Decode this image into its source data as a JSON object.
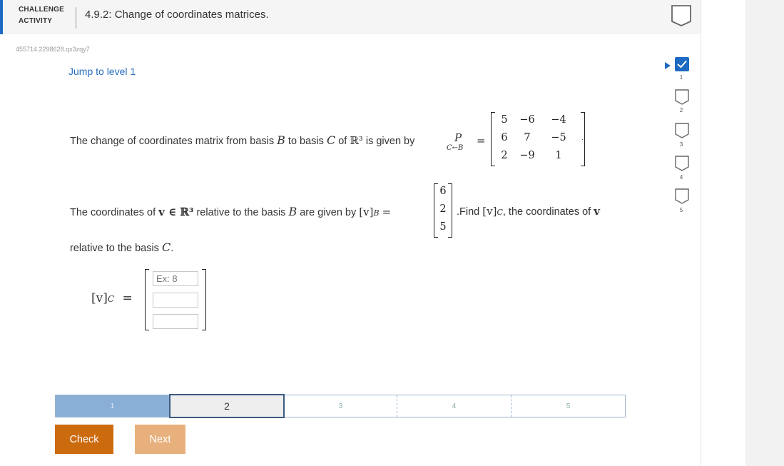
{
  "header": {
    "badge_line1": "CHALLENGE",
    "badge_line2": "ACTIVITY",
    "title": "4.9.2: Change of coordinates matrices."
  },
  "activity_id": "455714.2298628.qx3zqy7",
  "jump_link": "Jump to level 1",
  "problem": {
    "line1_text": "The change of coordinates matrix from basis ",
    "basis_b": "B",
    "basis_c": "C",
    "to_basis": " to basis ",
    "of": " of ",
    "r3": "ℝ³",
    "given_by": " is given by ",
    "p_symbol": "P",
    "p_sub": "C←B",
    "equals": "=",
    "matrix_p": [
      [
        "5",
        "−6",
        "−4"
      ],
      [
        "6",
        "7",
        "−5"
      ],
      [
        "2",
        "−9",
        "1"
      ]
    ],
    "period": ".",
    "line2_text": "The coordinates of ",
    "v_in_r3": "v ∈ ℝ³",
    "relative_to_b": " relative to the basis ",
    "are_given_by": " are given by ",
    "vb": "[v]",
    "vector_b": [
      "6",
      "2",
      "5"
    ],
    "find_text": ".Find ",
    "vc": "[v]",
    "coords_of": ", the coordinates of ",
    "v": "v",
    "line3_text": "relative to the basis ",
    "line3_end": "."
  },
  "answer": {
    "label": "[v]",
    "label_sub": "C",
    "equals": "=",
    "inputs": [
      {
        "placeholder": "Ex: 8",
        "value": ""
      },
      {
        "placeholder": "",
        "value": ""
      },
      {
        "placeholder": "",
        "value": ""
      }
    ]
  },
  "progress": {
    "segments": [
      "1",
      "2",
      "3",
      "4",
      "5"
    ],
    "current": 2
  },
  "buttons": {
    "check": "Check",
    "next": "Next"
  },
  "levels": [
    "1",
    "2",
    "3",
    "4",
    "5"
  ],
  "colors": {
    "accent": "#1e6ac2",
    "check_button": "#cc6a0e",
    "next_button": "#e8b07c",
    "progress_done": "#8aafd6",
    "link": "#2a6fbf"
  }
}
